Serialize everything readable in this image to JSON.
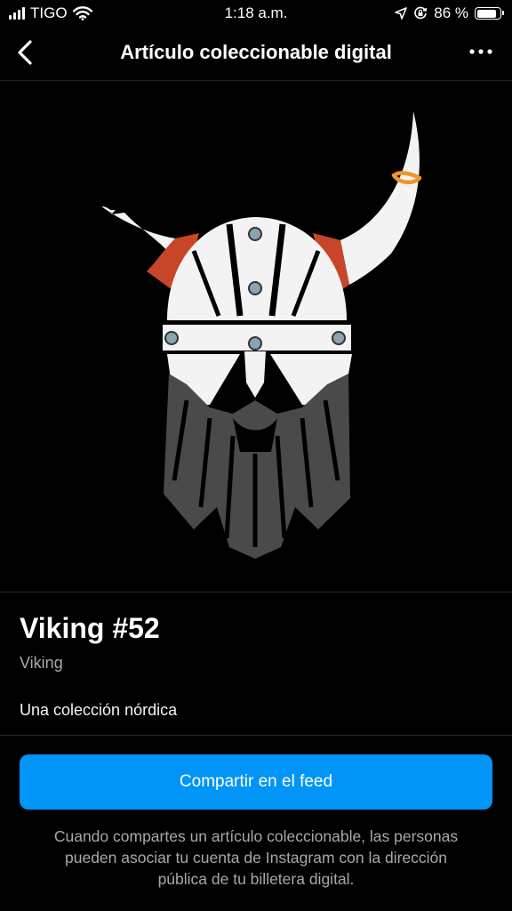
{
  "status_bar": {
    "carrier": "TIGO",
    "time": "1:18 a.m.",
    "battery_text": "86 %",
    "battery_level": 0.86,
    "icons": [
      "signal-icon",
      "wifi-icon",
      "location-icon",
      "orientation-lock-icon",
      "battery-icon"
    ]
  },
  "nav": {
    "title": "Artículo coleccionable digital",
    "back_icon": "chevron-left-icon",
    "more_icon": "more-horizontal-icon"
  },
  "item": {
    "title": "Viking #52",
    "collection": "Viking",
    "description": "Una colección nórdica"
  },
  "share_button": {
    "label": "Compartir en el feed"
  },
  "footer": {
    "line1": "Cuando compartes un artículo coleccionable, las personas",
    "line2": "pueden asociar tu cuenta de Instagram con la dirección",
    "line3": "pública de tu billetera digital."
  },
  "colors": {
    "background": "#000000",
    "accent": "#0095f6",
    "secondary_text": "#a8a8a8",
    "helmet_red": "#c8452a",
    "beard_gray": "#4a4a4a",
    "ring_orange": "#f0962a"
  }
}
